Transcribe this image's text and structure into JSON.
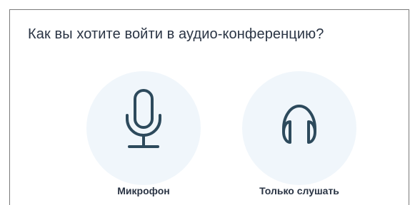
{
  "dialog": {
    "title": "Как вы хотите войти в аудио-конференцию?",
    "options": [
      {
        "label": "Микрофон",
        "icon": "microphone-icon"
      },
      {
        "label": "Только слушать",
        "icon": "headphones-icon"
      }
    ]
  },
  "colors": {
    "icon_stroke": "#2d4a5c",
    "circle_bg": "#f0f6fb",
    "text": "#2a3444",
    "border": "#7a7a7a"
  }
}
